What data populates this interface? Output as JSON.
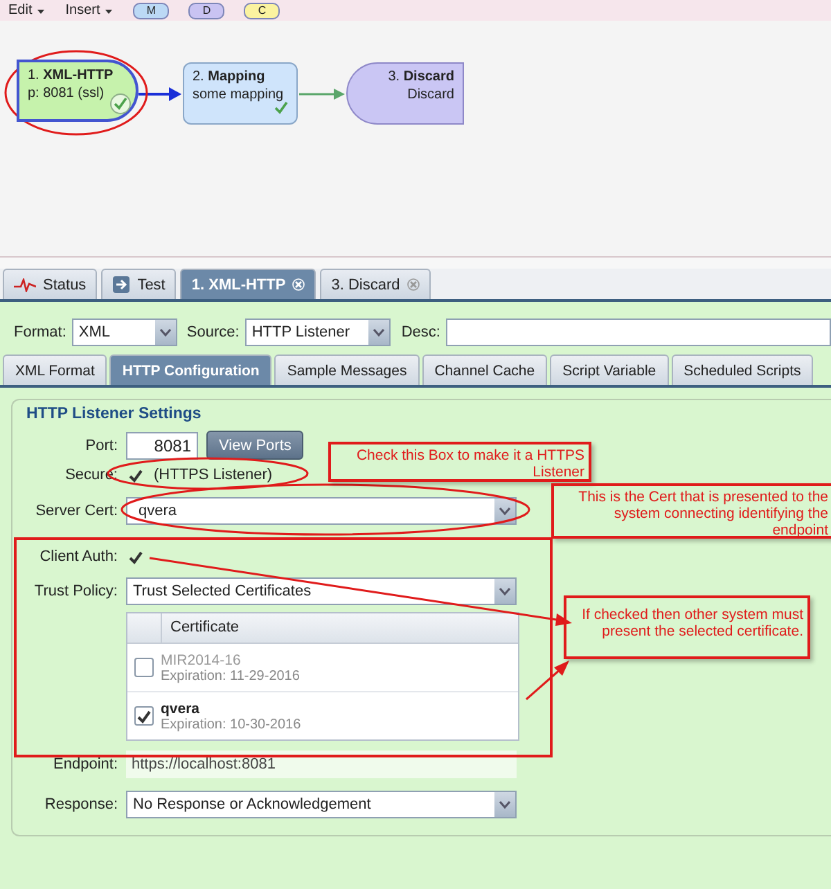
{
  "toolbar": {
    "menus": [
      "Edit",
      "Insert"
    ],
    "badges": [
      {
        "label": "M",
        "color": "#bcd9f5"
      },
      {
        "label": "D",
        "color": "#c9c3f2"
      },
      {
        "label": "C",
        "color": "#fbf3a0"
      }
    ]
  },
  "diagram": {
    "nodes": [
      {
        "kind": "source",
        "title": "1. **XML-HTTP**",
        "detail": "p: 8081 (ssl)",
        "valid": true
      },
      {
        "kind": "mapping",
        "title": "2. **Mapping**",
        "detail": "some mapping",
        "valid": true
      },
      {
        "kind": "destination",
        "title": "3. **Discard**",
        "detail": "Discard",
        "valid": false
      }
    ]
  },
  "tabs": [
    {
      "kind": "status",
      "label": "Status",
      "selected": false,
      "closable": false
    },
    {
      "kind": "test",
      "label": "Test",
      "selected": false,
      "closable": false
    },
    {
      "kind": "plain",
      "label": "1. XML-HTTP",
      "selected": true,
      "closable": true
    },
    {
      "kind": "plain",
      "label": "3. Discard",
      "selected": false,
      "closable": true
    }
  ],
  "channel": {
    "format": {
      "label": "Format:",
      "value": "XML"
    },
    "source": {
      "label": "Source:",
      "value": "HTTP Listener"
    },
    "desc": {
      "label": "Desc:"
    }
  },
  "subtabs": [
    {
      "label": "XML Format",
      "selected": false
    },
    {
      "label": "HTTP Configuration",
      "selected": true
    },
    {
      "label": "Sample Messages",
      "selected": false
    },
    {
      "label": "Channel Cache",
      "selected": false
    },
    {
      "label": "Script Variable",
      "selected": false
    },
    {
      "label": "Scheduled Scripts",
      "selected": false
    }
  ],
  "settings": {
    "title": "HTTP Listener Settings",
    "port": {
      "label": "Port:",
      "value": "8081"
    },
    "view_ports": "View Ports",
    "secure": {
      "label": "Secure:",
      "checked": true,
      "caption": "(HTTPS Listener)"
    },
    "server_cert": {
      "label": "Server Cert:",
      "value": "qvera"
    },
    "client_auth": {
      "label": "Client Auth:",
      "checked": true
    },
    "trust_policy": {
      "label": "Trust Policy:",
      "value": "Trust Selected Certificates"
    },
    "certificates": {
      "column": "Certificate",
      "rows": [
        {
          "name": "MIR2014-16",
          "expiration": "Expiration: 11-29-2016",
          "checked": false
        },
        {
          "name": "qvera",
          "expiration": "Expiration: 10-30-2016",
          "checked": true
        }
      ]
    },
    "endpoint": {
      "label": "Endpoint:",
      "value": "https://localhost:8081"
    },
    "response": {
      "label": "Response:",
      "value": "No Response or Acknowledgement"
    }
  },
  "callouts": [
    {
      "text": "Check this Box to make it a HTTPS Listener"
    },
    {
      "text": "This is the Cert that is presented to the system connecting identifying the endpoint"
    },
    {
      "text": "If checked then other system must present the selected certificate."
    }
  ]
}
